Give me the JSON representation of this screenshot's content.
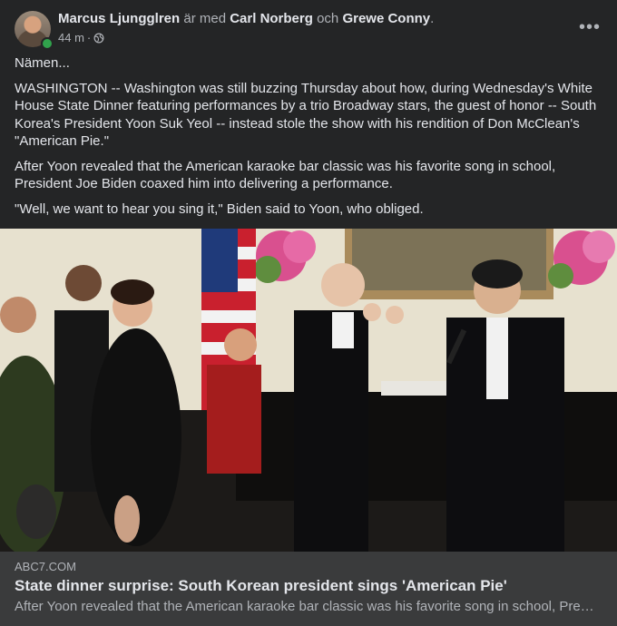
{
  "post": {
    "author": "Marcus Ljungglren",
    "with_text": "är med",
    "tagged_1": "Carl Norberg",
    "and_text": "och",
    "tagged_2": "Grewe Conny",
    "timestamp": "44 m",
    "dot": "·",
    "privacy_icon": "globe-icon",
    "more_label": "•••",
    "text": [
      "Nämen...",
      "WASHINGTON -- Washington was still buzzing Thursday about how, during Wednesday's White House State Dinner featuring performances by a trio Broadway stars, the guest of honor -- South Korea's President Yoon Suk Yeol -- instead stole the show with his rendition of Don McClean's \"American Pie.\"",
      "After Yoon revealed that the American karaoke bar classic was his favorite song in school, President Joe Biden coaxed him into delivering a performance.",
      "\"Well, we want to hear you sing it,\" Biden said to Yoon, who obliged."
    ]
  },
  "link": {
    "domain": "ABC7.COM",
    "title": "State dinner surprise: South Korean president sings 'American Pie'",
    "description": "After Yoon revealed that the American karaoke bar classic was his favorite song in school, President Joe Biden coaxed him into delivering a performance."
  },
  "colors": {
    "card_bg": "#242526",
    "link_bg": "#3a3b3c",
    "text_primary": "#e4e6eb",
    "text_secondary": "#b0b3b8",
    "online": "#31a24c"
  }
}
